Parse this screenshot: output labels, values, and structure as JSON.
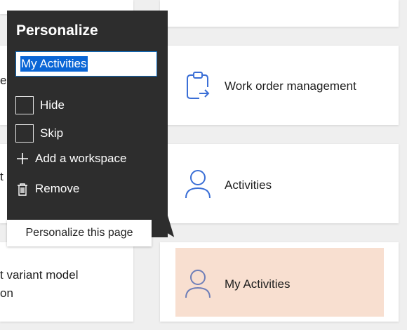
{
  "flyout": {
    "title": "Personalize",
    "name_value": "My Activities",
    "hide_label": "Hide",
    "skip_label": "Skip",
    "add_workspace_label": "Add a workspace",
    "remove_label": "Remove",
    "personalize_page_label": "Personalize this page"
  },
  "tiles": {
    "left_partial_1": "e",
    "left_partial_2": "t",
    "left_partial_3a": "t variant model",
    "left_partial_3b": "on",
    "work_order": "Work order management",
    "activities": "Activities",
    "my_activities": "My Activities"
  },
  "colors": {
    "accent": "#3b6fd6",
    "highlight": "#f8dfd0",
    "flyout_bg": "#2d2d2d"
  }
}
